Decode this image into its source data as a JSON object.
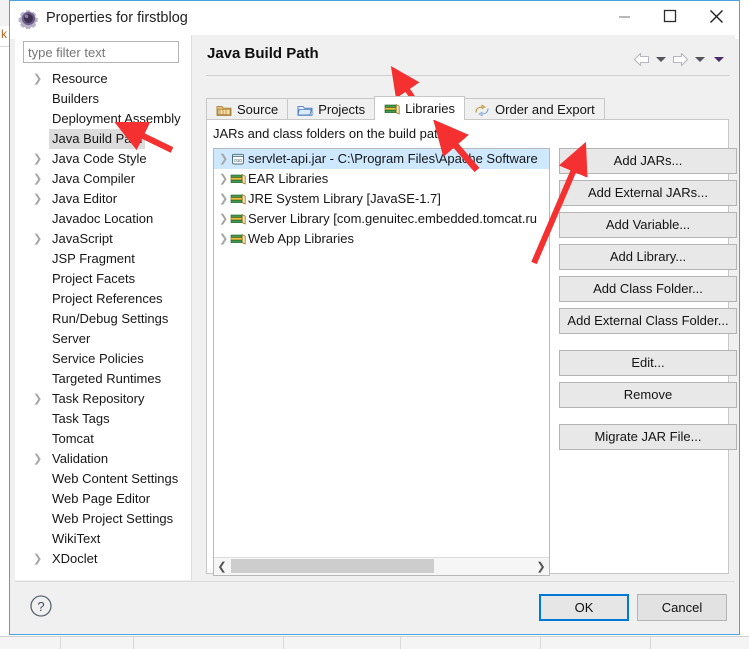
{
  "window": {
    "title": "Properties for firstblog",
    "icon": "gear-icon",
    "minimize_label": "—",
    "maximize_label": "□",
    "close_label": "✕",
    "border_color": "#4aa3df"
  },
  "sidebar": {
    "filter": {
      "value": "",
      "placeholder": "type filter text"
    },
    "items": [
      {
        "label": "Resource",
        "expandable": true,
        "selected": false
      },
      {
        "label": "Builders",
        "expandable": false,
        "selected": false
      },
      {
        "label": "Deployment Assembly",
        "expandable": false,
        "selected": false
      },
      {
        "label": "Java Build Path",
        "expandable": false,
        "selected": true
      },
      {
        "label": "Java Code Style",
        "expandable": true,
        "selected": false
      },
      {
        "label": "Java Compiler",
        "expandable": true,
        "selected": false
      },
      {
        "label": "Java Editor",
        "expandable": true,
        "selected": false
      },
      {
        "label": "Javadoc Location",
        "expandable": false,
        "selected": false
      },
      {
        "label": "JavaScript",
        "expandable": true,
        "selected": false
      },
      {
        "label": "JSP Fragment",
        "expandable": false,
        "selected": false
      },
      {
        "label": "Project Facets",
        "expandable": false,
        "selected": false
      },
      {
        "label": "Project References",
        "expandable": false,
        "selected": false
      },
      {
        "label": "Run/Debug Settings",
        "expandable": false,
        "selected": false
      },
      {
        "label": "Server",
        "expandable": false,
        "selected": false
      },
      {
        "label": "Service Policies",
        "expandable": false,
        "selected": false
      },
      {
        "label": "Targeted Runtimes",
        "expandable": false,
        "selected": false
      },
      {
        "label": "Task Repository",
        "expandable": true,
        "selected": false
      },
      {
        "label": "Task Tags",
        "expandable": false,
        "selected": false
      },
      {
        "label": "Tomcat",
        "expandable": false,
        "selected": false
      },
      {
        "label": "Validation",
        "expandable": true,
        "selected": false
      },
      {
        "label": "Web Content Settings",
        "expandable": false,
        "selected": false
      },
      {
        "label": "Web Page Editor",
        "expandable": false,
        "selected": false
      },
      {
        "label": "Web Project Settings",
        "expandable": false,
        "selected": false
      },
      {
        "label": "WikiText",
        "expandable": false,
        "selected": false
      },
      {
        "label": "XDoclet",
        "expandable": true,
        "selected": false
      }
    ]
  },
  "page": {
    "title": "Java Build Path",
    "nav": {
      "back_icon": "back-arrow-icon",
      "back_caret_icon": "chevron-down-icon",
      "forward_icon": "forward-arrow-icon",
      "forward_caret_icon": "chevron-down-icon",
      "menu_caret_icon": "chevron-down-icon"
    },
    "tabs": [
      {
        "label": "Source",
        "icon": "source-folder-icon",
        "active": false
      },
      {
        "label": "Projects",
        "icon": "projects-folder-icon",
        "active": false
      },
      {
        "label": "Libraries",
        "icon": "libraries-books-icon",
        "active": true
      },
      {
        "label": "Order and Export",
        "icon": "order-export-icon",
        "active": false
      }
    ],
    "body_label": "JARs and class folders on the build path:",
    "entries": [
      {
        "label": "servlet-api.jar - C:\\Program Files\\Apache Software",
        "icon": "jar-icon",
        "selected": true,
        "expandable": true
      },
      {
        "label": "EAR Libraries",
        "icon": "library-books-icon",
        "selected": false,
        "expandable": true
      },
      {
        "label": "JRE System Library [JavaSE-1.7]",
        "icon": "library-books-icon",
        "selected": false,
        "expandable": true
      },
      {
        "label": "Server Library [com.genuitec.embedded.tomcat.ru",
        "icon": "library-books-icon",
        "selected": false,
        "expandable": true
      },
      {
        "label": "Web App Libraries",
        "icon": "library-books-icon",
        "selected": false,
        "expandable": true
      }
    ],
    "scrollbar": {
      "left_arrow": "❮",
      "right_arrow": "❯"
    },
    "buttons": [
      {
        "label": "Add JARs...",
        "gap": false
      },
      {
        "label": "Add External JARs...",
        "gap": false
      },
      {
        "label": "Add Variable...",
        "gap": false
      },
      {
        "label": "Add Library...",
        "gap": false
      },
      {
        "label": "Add Class Folder...",
        "gap": false
      },
      {
        "label": "Add External Class Folder...",
        "gap": false
      },
      {
        "label": "Edit...",
        "gap": true
      },
      {
        "label": "Remove",
        "gap": false
      },
      {
        "label": "Migrate JAR File...",
        "gap": true
      }
    ]
  },
  "footer": {
    "help_icon": "help-question-icon",
    "ok_label": "OK",
    "cancel_label": "Cancel"
  },
  "annotations": {
    "color": "#f43030",
    "arrows": [
      {
        "name": "arrow-to-java-build-path",
        "points_to": "Java Build Path"
      },
      {
        "name": "arrow-to-libraries-tab",
        "points_to": "Libraries"
      },
      {
        "name": "arrow-to-servlet-api-entry",
        "points_to": "servlet-api.jar"
      },
      {
        "name": "arrow-to-add-external-jars",
        "points_to": "Add External JARs..."
      }
    ]
  }
}
